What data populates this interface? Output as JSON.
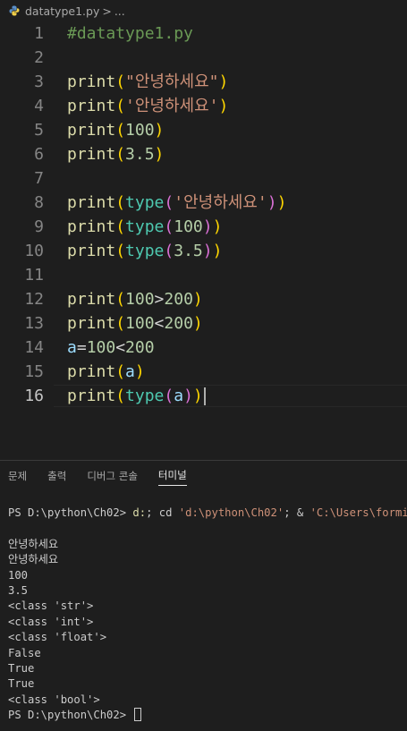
{
  "breadcrumb": {
    "file": "datatype1.py",
    "separator": ">",
    "more": "..."
  },
  "code_lines": [
    {
      "n": "1",
      "tokens": [
        {
          "t": "#datatype1.py",
          "c": "cm"
        }
      ]
    },
    {
      "n": "2",
      "tokens": []
    },
    {
      "n": "3",
      "tokens": [
        {
          "t": "print",
          "c": "fn"
        },
        {
          "t": "(",
          "c": "b1"
        },
        {
          "t": "\"안녕하세요\"",
          "c": "str"
        },
        {
          "t": ")",
          "c": "b1"
        }
      ]
    },
    {
      "n": "4",
      "tokens": [
        {
          "t": "print",
          "c": "fn"
        },
        {
          "t": "(",
          "c": "b1"
        },
        {
          "t": "'안녕하세요'",
          "c": "str"
        },
        {
          "t": ")",
          "c": "b1"
        }
      ]
    },
    {
      "n": "5",
      "tokens": [
        {
          "t": "print",
          "c": "fn"
        },
        {
          "t": "(",
          "c": "b1"
        },
        {
          "t": "100",
          "c": "num"
        },
        {
          "t": ")",
          "c": "b1"
        }
      ]
    },
    {
      "n": "6",
      "tokens": [
        {
          "t": "print",
          "c": "fn"
        },
        {
          "t": "(",
          "c": "b1"
        },
        {
          "t": "3.5",
          "c": "num"
        },
        {
          "t": ")",
          "c": "b1"
        }
      ]
    },
    {
      "n": "7",
      "tokens": []
    },
    {
      "n": "8",
      "tokens": [
        {
          "t": "print",
          "c": "fn"
        },
        {
          "t": "(",
          "c": "b1"
        },
        {
          "t": "type",
          "c": "builtin"
        },
        {
          "t": "(",
          "c": "b2"
        },
        {
          "t": "'안녕하세요'",
          "c": "str"
        },
        {
          "t": ")",
          "c": "b2"
        },
        {
          "t": ")",
          "c": "b1"
        }
      ]
    },
    {
      "n": "9",
      "tokens": [
        {
          "t": "print",
          "c": "fn"
        },
        {
          "t": "(",
          "c": "b1"
        },
        {
          "t": "type",
          "c": "builtin"
        },
        {
          "t": "(",
          "c": "b2"
        },
        {
          "t": "100",
          "c": "num"
        },
        {
          "t": ")",
          "c": "b2"
        },
        {
          "t": ")",
          "c": "b1"
        }
      ]
    },
    {
      "n": "10",
      "tokens": [
        {
          "t": "print",
          "c": "fn"
        },
        {
          "t": "(",
          "c": "b1"
        },
        {
          "t": "type",
          "c": "builtin"
        },
        {
          "t": "(",
          "c": "b2"
        },
        {
          "t": "3.5",
          "c": "num"
        },
        {
          "t": ")",
          "c": "b2"
        },
        {
          "t": ")",
          "c": "b1"
        }
      ]
    },
    {
      "n": "11",
      "tokens": []
    },
    {
      "n": "12",
      "tokens": [
        {
          "t": "print",
          "c": "fn"
        },
        {
          "t": "(",
          "c": "b1"
        },
        {
          "t": "100",
          "c": "num"
        },
        {
          "t": ">",
          "c": "op"
        },
        {
          "t": "200",
          "c": "num"
        },
        {
          "t": ")",
          "c": "b1"
        }
      ]
    },
    {
      "n": "13",
      "tokens": [
        {
          "t": "print",
          "c": "fn"
        },
        {
          "t": "(",
          "c": "b1"
        },
        {
          "t": "100",
          "c": "num"
        },
        {
          "t": "<",
          "c": "op"
        },
        {
          "t": "200",
          "c": "num"
        },
        {
          "t": ")",
          "c": "b1"
        }
      ]
    },
    {
      "n": "14",
      "tokens": [
        {
          "t": "a",
          "c": "var"
        },
        {
          "t": "=",
          "c": "op"
        },
        {
          "t": "100",
          "c": "num"
        },
        {
          "t": "<",
          "c": "op"
        },
        {
          "t": "200",
          "c": "num"
        }
      ]
    },
    {
      "n": "15",
      "tokens": [
        {
          "t": "print",
          "c": "fn"
        },
        {
          "t": "(",
          "c": "b1"
        },
        {
          "t": "a",
          "c": "var"
        },
        {
          "t": ")",
          "c": "b1"
        }
      ]
    },
    {
      "n": "16",
      "tokens": [
        {
          "t": "print",
          "c": "fn"
        },
        {
          "t": "(",
          "c": "b1"
        },
        {
          "t": "type",
          "c": "builtin"
        },
        {
          "t": "(",
          "c": "b2"
        },
        {
          "t": "a",
          "c": "var"
        },
        {
          "t": ")",
          "c": "b2"
        },
        {
          "t": ")",
          "c": "b1"
        }
      ],
      "active": true
    }
  ],
  "panel": {
    "tabs": [
      {
        "label": "문제",
        "active": false
      },
      {
        "label": "출력",
        "active": false
      },
      {
        "label": "디버그 콘솔",
        "active": false
      },
      {
        "label": "터미널",
        "active": true
      }
    ]
  },
  "terminal": {
    "command_line": {
      "prompt": "PS D:\\python\\Ch02> ",
      "cmd": "d:",
      "rest1": "; cd ",
      "path": "'d:\\python\\Ch02'",
      "rest2": "; & ",
      "path2": "'C:\\Users\\formi\\AppData"
    },
    "output": [
      "안녕하세요",
      "안녕하세요",
      "100",
      "3.5",
      "<class 'str'>",
      "<class 'int'>",
      "<class 'float'>",
      "False",
      "True",
      "True",
      "<class 'bool'>"
    ],
    "final_prompt": "PS D:\\python\\Ch02> "
  }
}
